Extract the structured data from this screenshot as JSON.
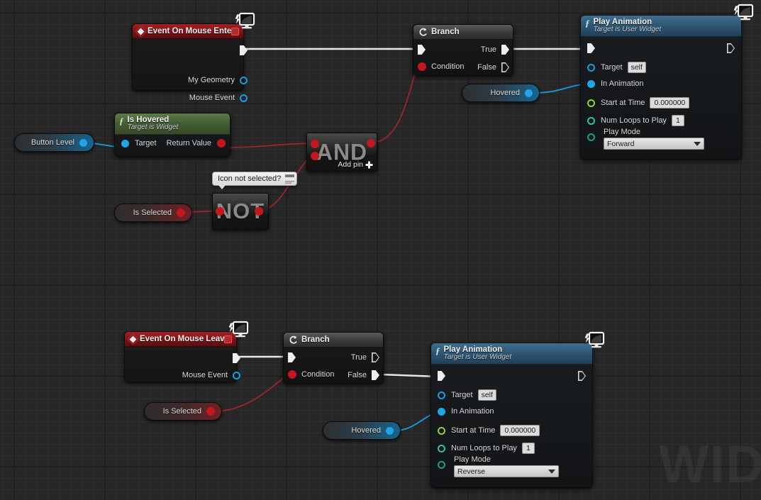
{
  "graph": {
    "watermark": "WID"
  },
  "nodes": {
    "event_mouse_enter": {
      "title": "Event On Mouse Enter",
      "outputs": [
        "My Geometry",
        "Mouse Event"
      ]
    },
    "branch_top": {
      "title": "Branch",
      "input_label": "Condition",
      "true_label": "True",
      "false_label": "False"
    },
    "play_anim_top": {
      "title": "Play Animation",
      "subtitle": "Target is User Widget",
      "target_label": "Target",
      "target_value": "self",
      "in_animation_label": "In Animation",
      "start_at_time_label": "Start at Time",
      "start_at_time_value": "0.000000",
      "num_loops_label": "Num Loops to Play",
      "num_loops_value": "1",
      "play_mode_label": "Play Mode",
      "play_mode_value": "Forward"
    },
    "is_hovered": {
      "title": "Is Hovered",
      "subtitle": "Target is Widget",
      "target_label": "Target",
      "return_label": "Return Value"
    },
    "button_level": {
      "label": "Button Level"
    },
    "and_node": {
      "label": "AND",
      "add_pin_label": "Add pin"
    },
    "not_node": {
      "label": "NOT"
    },
    "is_selected_top": {
      "label": "Is Selected"
    },
    "hovered_top": {
      "label": "Hovered"
    },
    "comment_bubble": {
      "text": "Icon not selected?"
    },
    "event_mouse_leave": {
      "title": "Event On Mouse Leave",
      "outputs": [
        "Mouse Event"
      ]
    },
    "branch_bottom": {
      "title": "Branch",
      "input_label": "Condition",
      "true_label": "True",
      "false_label": "False"
    },
    "play_anim_bottom": {
      "title": "Play Animation",
      "subtitle": "Target is User Widget",
      "target_label": "Target",
      "target_value": "self",
      "in_animation_label": "In Animation",
      "start_at_time_label": "Start at Time",
      "start_at_time_value": "0.000000",
      "num_loops_label": "Num Loops to Play",
      "num_loops_value": "1",
      "play_mode_label": "Play Mode",
      "play_mode_value": "Reverse"
    },
    "is_selected_bottom": {
      "label": "Is Selected"
    },
    "hovered_bottom": {
      "label": "Hovered"
    }
  },
  "colors": {
    "exec_wire": "#e8e8e8",
    "bool_wire": "#a3252a",
    "object_wire": "#169ad6",
    "event_header": "#8d181c",
    "function_header": "#34607f",
    "pure_function_header": "#4e6a3b"
  }
}
